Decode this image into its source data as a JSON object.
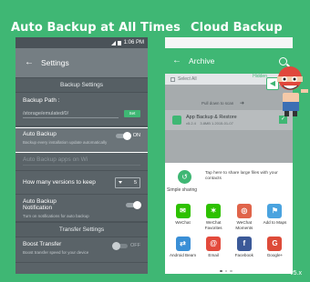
{
  "headlines": {
    "left": "Auto Backup at All Times",
    "right": "Cloud Backup"
  },
  "left_phone": {
    "status_time": "1:06 PM",
    "toolbar_title": "Settings",
    "section_backup": "Backup Settings",
    "backup_path_label": "Backup Path :",
    "backup_path_value": "/storage/emulated/0/",
    "set_label": "Set",
    "auto_backup_title": "Auto Backup",
    "auto_backup_desc": "Backup every installation update automatically",
    "auto_backup_toggle": "ON",
    "auto_backup_on_wifi": "Auto Backup apps on Wi",
    "versions_label": "How many versions to keep",
    "versions_value": "5",
    "notify_title": "Auto Backup Notification",
    "notify_desc": "Turn on notifications for auto backup",
    "section_transfer": "Transfer Settings",
    "boost_title": "Boost Transfer",
    "boost_desc": "Boost transfer speed for your device",
    "boost_toggle": "OFF"
  },
  "right_phone": {
    "toolbar_title": "Archive",
    "hidden_label": "Hidden",
    "select_all": "Select All",
    "pull_hint": "Pull down to scan",
    "app_name": "App Backup & Restore",
    "app_meta": "v5.2.4",
    "app_size": "3.8MB 1.2015-01-07",
    "sheet_hint": "Tap here to share large files with your contacts",
    "simple_sharing": "Simple sharing",
    "targets": [
      [
        {
          "label": "WeChat",
          "icon": "wechat-icon",
          "color": "#2dc100"
        },
        {
          "label": "WeChat Favorites",
          "icon": "wechat-favorites-icon",
          "color": "#2dc100"
        },
        {
          "label": "WeChat Moments",
          "icon": "wechat-moments-icon",
          "color": "#e0644a"
        },
        {
          "label": "Add to Maps",
          "icon": "maps-icon",
          "color": "#4aa3df"
        }
      ],
      [
        {
          "label": "Android Beam",
          "icon": "android-beam-icon",
          "color": "#3a8fd6"
        },
        {
          "label": "Email",
          "icon": "email-icon",
          "color": "#e34a3c"
        },
        {
          "label": "Facebook",
          "icon": "facebook-icon",
          "color": "#3b5998"
        },
        {
          "label": "Google+",
          "icon": "google-plus-icon",
          "color": "#dd4b39"
        }
      ]
    ]
  },
  "version": "v5.x"
}
